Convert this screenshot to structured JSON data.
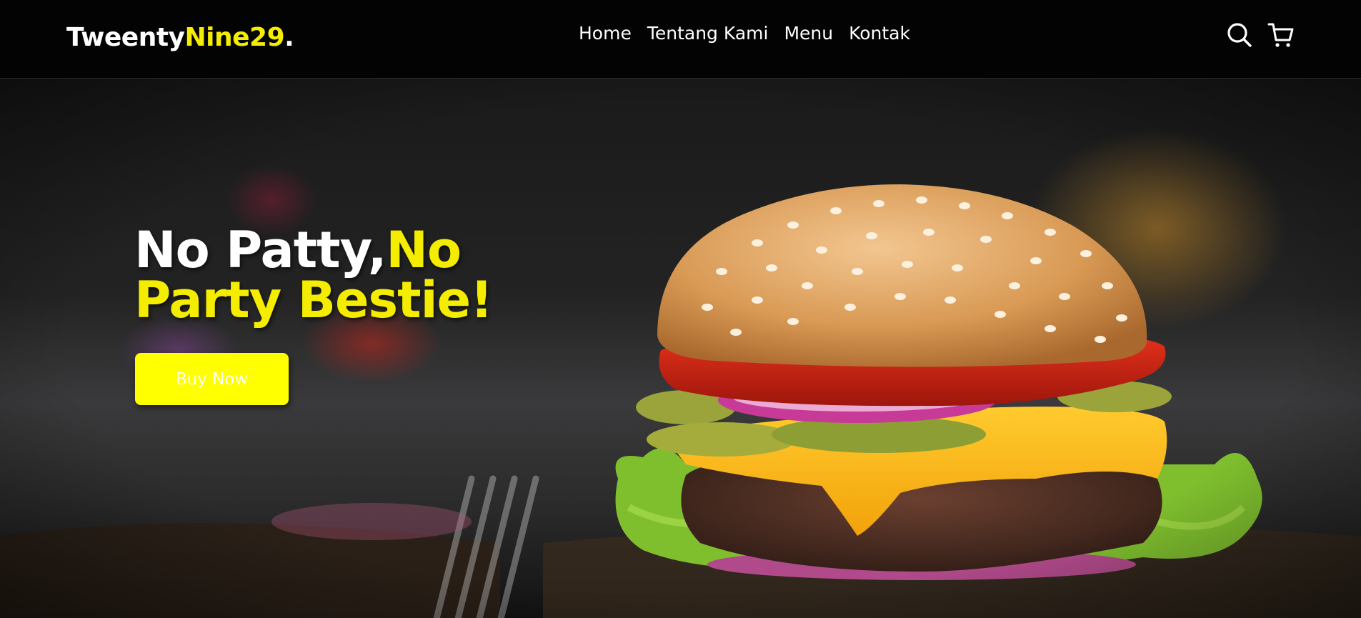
{
  "brand": {
    "name_white": "Tweenty",
    "name_yellow": "Nine29",
    "dot": "."
  },
  "nav": {
    "links": [
      "Home",
      "Tentang Kami",
      "Menu",
      "Kontak"
    ],
    "icons": [
      "search-icon",
      "cart-icon"
    ]
  },
  "hero": {
    "headline_line1_white": "No Patty,",
    "headline_line1_yellow": "No",
    "headline_line2_yellow": "Party Bestie!",
    "button_label": "Buy Now",
    "image": "burger-photo"
  },
  "colors": {
    "accent": "#ffff00",
    "nav_background": "#030303",
    "text": "#ffffff"
  }
}
